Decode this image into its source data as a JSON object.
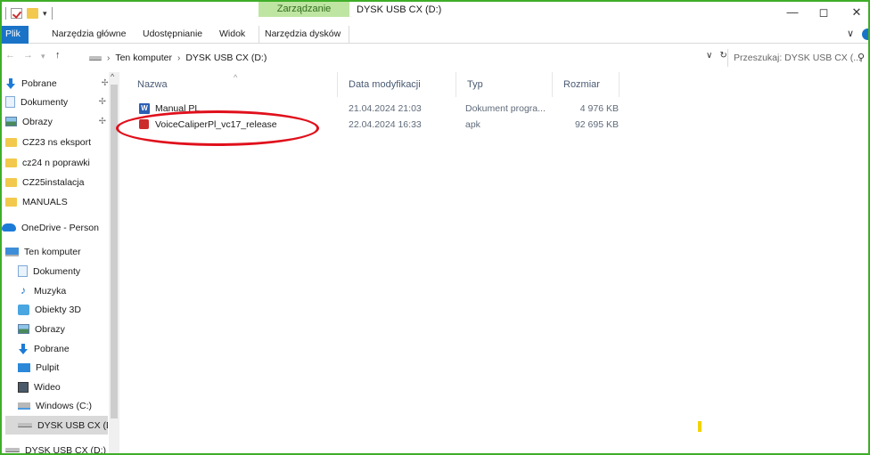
{
  "titlebar": {
    "context_tab": "Zarządzanie",
    "window_title": "DYSK USB CX (D:)",
    "minimize": "—",
    "maximize": "◻",
    "close": "✕"
  },
  "ribbon": {
    "tabs": [
      {
        "label": "Plik"
      },
      {
        "label": "Narzędzia główne"
      },
      {
        "label": "Udostępnianie"
      },
      {
        "label": "Widok"
      },
      {
        "label": "Narzędzia dysków"
      }
    ],
    "colors": {
      "file_tab": "#1a73c7",
      "context_tab_bg": "#bfe5a3"
    }
  },
  "address": {
    "crumbs": [
      "Ten komputer",
      "DYSK USB CX (D:)"
    ],
    "search_placeholder": "Przeszukaj: DYSK USB CX (..."
  },
  "sidebar": {
    "quick_access": [
      {
        "label": "Pobrane",
        "icon": "download-icon",
        "pinned": true
      },
      {
        "label": "Dokumenty",
        "icon": "documents-icon",
        "pinned": true
      },
      {
        "label": "Obrazy",
        "icon": "pictures-icon",
        "pinned": true
      },
      {
        "label": "CZ23 ns eksport",
        "icon": "folder-icon"
      },
      {
        "label": "cz24 n poprawki",
        "icon": "folder-icon"
      },
      {
        "label": "CZ25instalacja",
        "icon": "folder-icon"
      },
      {
        "label": "MANUALS",
        "icon": "folder-icon"
      }
    ],
    "onedrive": {
      "label": "OneDrive - Person",
      "icon": "onedrive-icon"
    },
    "this_pc": [
      {
        "label": "Ten komputer",
        "icon": "computer-icon"
      },
      {
        "label": "Dokumenty",
        "icon": "documents-icon"
      },
      {
        "label": "Muzyka",
        "icon": "music-icon"
      },
      {
        "label": "Obiekty 3D",
        "icon": "objects3d-icon"
      },
      {
        "label": "Obrazy",
        "icon": "pictures-icon"
      },
      {
        "label": "Pobrane",
        "icon": "download-icon"
      },
      {
        "label": "Pulpit",
        "icon": "desktop-icon"
      },
      {
        "label": "Wideo",
        "icon": "video-icon"
      },
      {
        "label": "Windows (C:)",
        "icon": "windows-drive-icon"
      },
      {
        "label": "DYSK USB CX (D:",
        "icon": "usb-drive-icon",
        "selected": true
      }
    ],
    "bottom_drive": {
      "label": "DYSK USB CX (D:)",
      "icon": "usb-drive-icon"
    }
  },
  "table": {
    "columns": {
      "name": "Nazwa",
      "modified": "Data modyfikacji",
      "type": "Typ",
      "size": "Rozmiar"
    },
    "rows": [
      {
        "name": "Manual PL",
        "modified": "21.04.2024 21:03",
        "type": "Dokument progra...",
        "size": "4 976 KB",
        "icon": "word-document-icon"
      },
      {
        "name": "VoiceCaliperPl_vc17_release",
        "modified": "22.04.2024 16:33",
        "type": "apk",
        "size": "92 695 KB",
        "icon": "apk-file-icon"
      }
    ]
  },
  "annotation_color": "#e0101c"
}
